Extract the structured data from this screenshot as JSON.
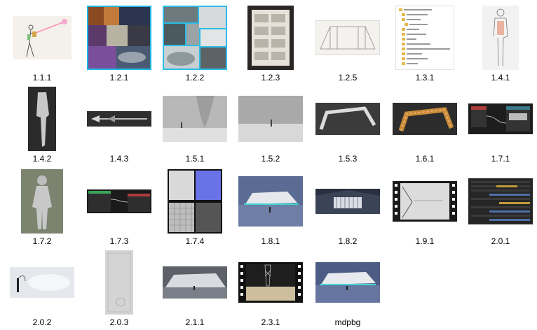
{
  "folder": {
    "items": [
      {
        "name": "1.1.1"
      },
      {
        "name": "1.2.1"
      },
      {
        "name": "1.2.2"
      },
      {
        "name": "1.2.3"
      },
      {
        "name": "1.2.5"
      },
      {
        "name": "1.3.1"
      },
      {
        "name": "1.4.1"
      },
      {
        "name": "1.4.2"
      },
      {
        "name": "1.4.3"
      },
      {
        "name": "1.5.1"
      },
      {
        "name": "1.5.2"
      },
      {
        "name": "1.5.3"
      },
      {
        "name": "1.6.1"
      },
      {
        "name": "1.7.1"
      },
      {
        "name": "1.7.2"
      },
      {
        "name": "1.7.3"
      },
      {
        "name": "1.7.4"
      },
      {
        "name": "1.8.1"
      },
      {
        "name": "1.8.2"
      },
      {
        "name": "1.9.1"
      },
      {
        "name": "2.0.1"
      },
      {
        "name": "2.0.2"
      },
      {
        "name": "2.0.3"
      },
      {
        "name": "2.1.1"
      },
      {
        "name": "2.3.1"
      },
      {
        "name": "mdpbg"
      }
    ]
  }
}
